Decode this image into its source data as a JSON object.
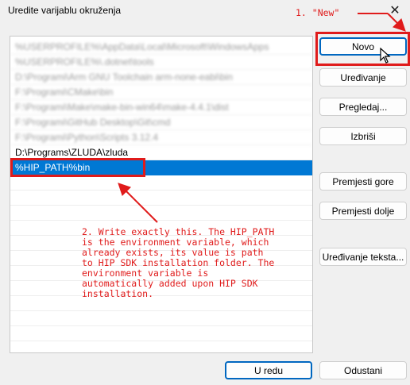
{
  "window": {
    "title": "Uredite varijablu okruženja",
    "close_glyph": "✕"
  },
  "list": {
    "items": [
      {
        "text": "%USERPROFILE%\\AppData\\Local\\Microsoft\\WindowsApps",
        "blurred": true
      },
      {
        "text": "%USERPROFILE%\\.dotnet\\tools",
        "blurred": true
      },
      {
        "text": "D:\\Programi\\Arm GNU Toolchain arm-none-eabi\\bin",
        "blurred": true
      },
      {
        "text": "F:\\Programi\\CMake\\bin",
        "blurred": true
      },
      {
        "text": "F:\\Programi\\Make\\make-bin-win64\\make-4.4.1\\dist",
        "blurred": true
      },
      {
        "text": "F:\\Programi\\GitHub Desktop\\Git\\cmd",
        "blurred": true
      },
      {
        "text": "F:\\Programi\\Python\\Scripts 3.12.4",
        "blurred": true
      },
      {
        "text": "D:\\Programs\\ZLUDA\\zluda",
        "blurred": false
      },
      {
        "text": "%HIP_PATH%bin",
        "blurred": false,
        "selected": true
      }
    ]
  },
  "buttons": {
    "new": "Novo",
    "edit": "Uređivanje",
    "browse": "Pregledaj...",
    "delete": "Izbriši",
    "move_up": "Premjesti gore",
    "move_down": "Premjesti dolje",
    "edit_text": "Uređivanje teksta...",
    "ok": "U redu",
    "cancel": "Odustani"
  },
  "annotations": {
    "step1": "1. \"New\"",
    "step2": "2. Write exactly this. The HIP_PATH\nis the environment variable, which\nalready exists, its value is path\nto HIP SDK installation folder. The\nenvironment variable is\nautomatically added upon HIP SDK\ninstallation.",
    "color": "#e01b1b"
  }
}
